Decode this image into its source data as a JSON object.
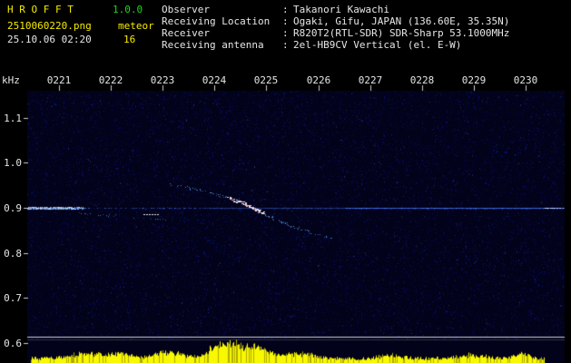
{
  "header": {
    "app_name": "H R O F F T",
    "version": "1.0.0",
    "filename": "2510060220.png",
    "mode": "meteor",
    "datetime": "25.10.06 02:20",
    "count": "16",
    "colon": ":",
    "info": [
      {
        "label": "Observer",
        "value": "Takanori Kawachi"
      },
      {
        "label": "Receiving Location",
        "value": "Ogaki, Gifu, JAPAN (136.60E, 35.35N)"
      },
      {
        "label": "Receiver",
        "value": "R820T2(RTL-SDR) SDR-Sharp 53.1000MHz"
      },
      {
        "label": "Receiving antenna",
        "value": "2el-HB9CV Vertical (el. E-W)"
      }
    ]
  },
  "colors": {
    "text_yellow": "#f5ec00",
    "text_green": "#16dc16",
    "text_white": "#e6e6e6",
    "carrier_blue": "#4678ff",
    "noise_yellow": "#f8f800",
    "echo_pink": "#ffbed2"
  },
  "chart_data": {
    "type": "heatmap",
    "title": "HROFFT meteor radio spectrogram 53.1000MHz",
    "ylabel": "kHz",
    "x_ticks": [
      "0221",
      "0222",
      "0223",
      "0224",
      "0225",
      "0226",
      "0227",
      "0228",
      "0229",
      "0230"
    ],
    "y_ticks": [
      "1.1",
      "1.0",
      "0.9",
      "0.8",
      "0.7",
      "0.6"
    ],
    "y_tick_values": [
      1.1,
      1.0,
      0.9,
      0.8,
      0.7,
      0.6
    ],
    "ylim": [
      0.555,
      1.16
    ],
    "carrier_khz": 0.9,
    "marker_khz": 0.614,
    "meteor_trace": [
      [
        2.12,
        0.952
      ],
      [
        2.45,
        0.944
      ],
      [
        2.8,
        0.936
      ],
      [
        3.15,
        0.926
      ],
      [
        3.45,
        0.914
      ],
      [
        3.68,
        0.902
      ],
      [
        3.89,
        0.89
      ],
      [
        4.12,
        0.876
      ],
      [
        4.38,
        0.864
      ],
      [
        4.68,
        0.851
      ],
      [
        4.99,
        0.841
      ],
      [
        5.31,
        0.831
      ]
    ],
    "bright_segment_t": [
      3.25,
      3.95
    ],
    "left_trace": [
      [
        0.4,
        0.888
      ],
      [
        1.31,
        0.88
      ],
      [
        2.15,
        0.872
      ]
    ],
    "white_dash": {
      "t1": 1.63,
      "t2": 1.94,
      "f": 0.886
    },
    "noise_bumps": [
      {
        "t": 0.53,
        "a": 6,
        "w": 0.45
      },
      {
        "t": 1.23,
        "a": 5,
        "w": 0.26
      },
      {
        "t": 2.1,
        "a": 8,
        "w": 0.35
      },
      {
        "t": 3.06,
        "a": 12,
        "w": 0.32
      },
      {
        "t": 3.5,
        "a": 14,
        "w": 0.35
      },
      {
        "t": 3.94,
        "a": 10,
        "w": 0.26
      },
      {
        "t": 4.64,
        "a": 6,
        "w": 0.35
      },
      {
        "t": 6.39,
        "a": 4,
        "w": 0.26
      },
      {
        "t": 7.97,
        "a": 4,
        "w": 0.35
      },
      {
        "t": 8.93,
        "a": 5,
        "w": 0.21
      }
    ]
  }
}
